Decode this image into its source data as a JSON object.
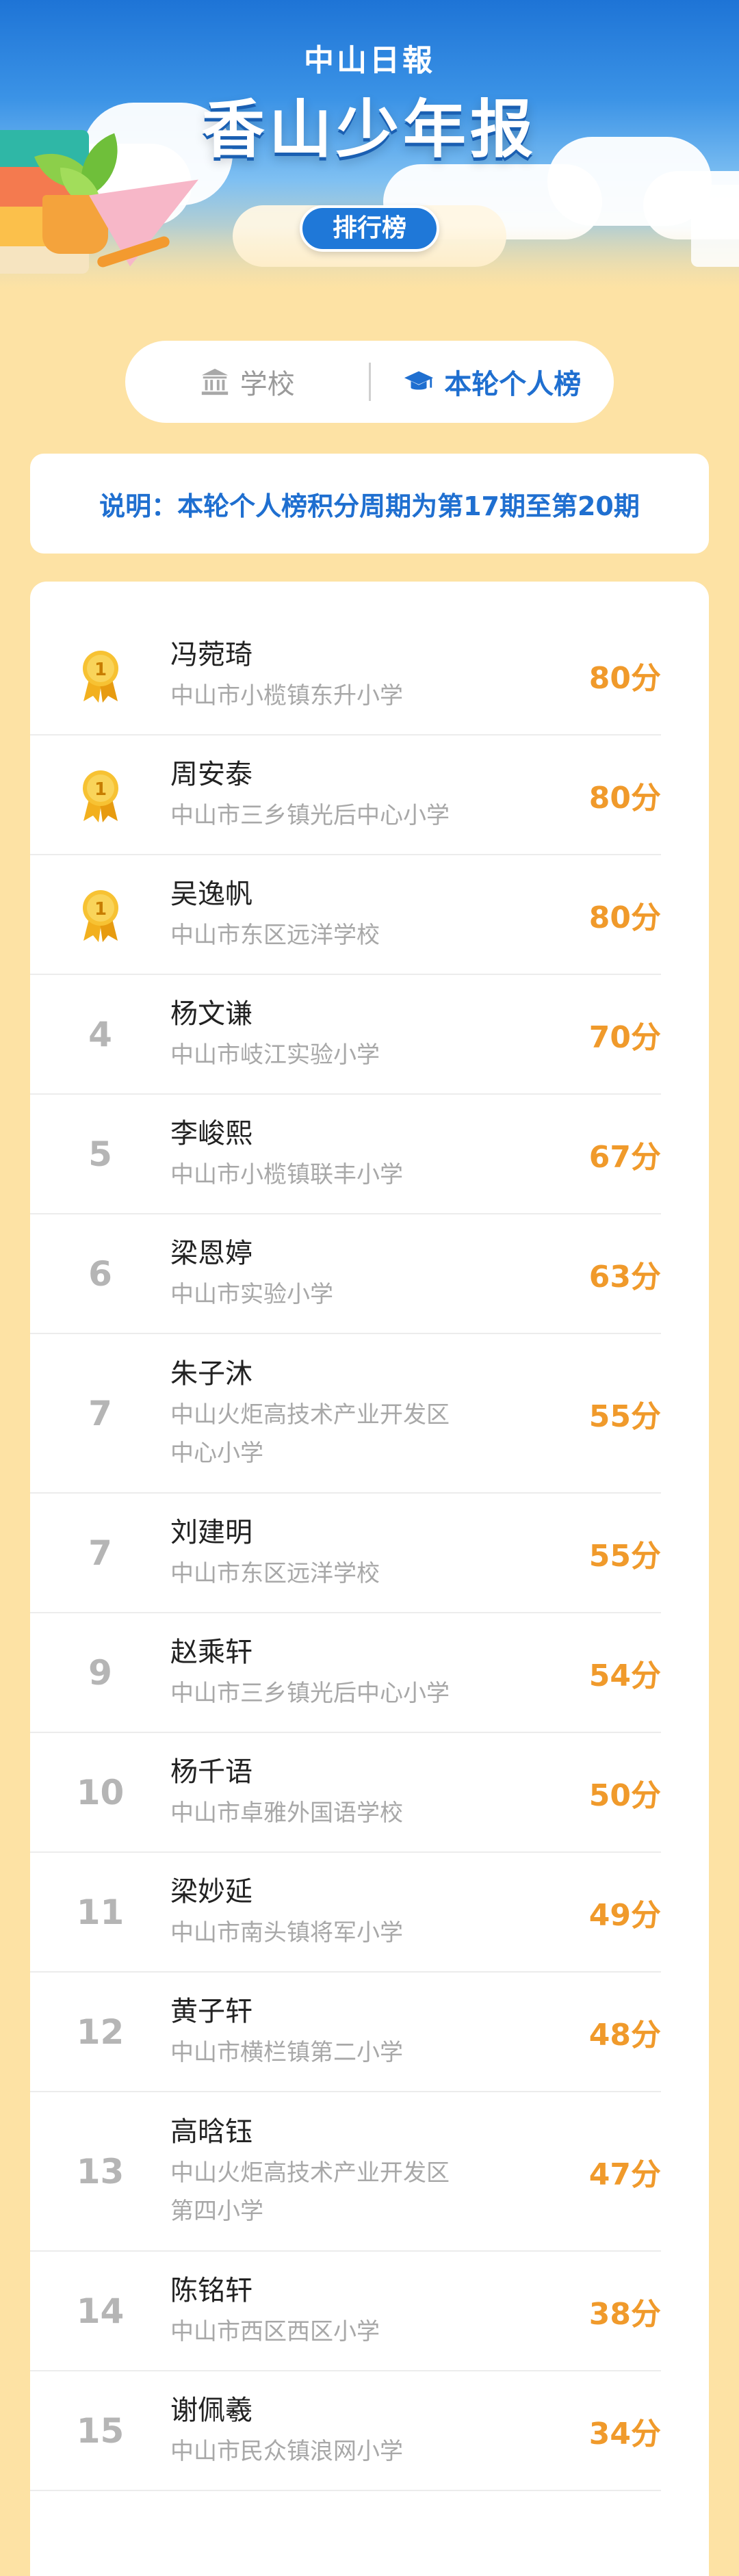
{
  "header": {
    "paper_name": "中山日報",
    "title": "香山少年报",
    "badge": "排行榜"
  },
  "tabs": {
    "school_label": "学校",
    "personal_label": "本轮个人榜",
    "active": "personal"
  },
  "notice": "说明：本轮个人榜积分周期为第17期至第20期",
  "colors": {
    "accent_blue": "#1f6fd0",
    "score_orange": "#f09a2b",
    "page_bg": "#fde2a4"
  },
  "rankings": [
    {
      "rank": "1",
      "medal": true,
      "name": "冯菀琦",
      "school": "中山市小榄镇东升小学",
      "score": "80分"
    },
    {
      "rank": "1",
      "medal": true,
      "name": "周安泰",
      "school": "中山市三乡镇光后中心小学",
      "score": "80分"
    },
    {
      "rank": "1",
      "medal": true,
      "name": "吴逸帆",
      "school": "中山市东区远洋学校",
      "score": "80分"
    },
    {
      "rank": "4",
      "medal": false,
      "name": "杨文谦",
      "school": "中山市岐江实验小学",
      "score": "70分"
    },
    {
      "rank": "5",
      "medal": false,
      "name": "李峻熙",
      "school": "中山市小榄镇联丰小学",
      "score": "67分"
    },
    {
      "rank": "6",
      "medal": false,
      "name": "梁恩婷",
      "school": "中山市实验小学",
      "score": "63分"
    },
    {
      "rank": "7",
      "medal": false,
      "name": "朱子沐",
      "school": "中山火炬高技术产业开发区中心小学",
      "score": "55分"
    },
    {
      "rank": "7",
      "medal": false,
      "name": "刘建明",
      "school": "中山市东区远洋学校",
      "score": "55分"
    },
    {
      "rank": "9",
      "medal": false,
      "name": "赵乘轩",
      "school": "中山市三乡镇光后中心小学",
      "score": "54分"
    },
    {
      "rank": "10",
      "medal": false,
      "name": "杨千语",
      "school": "中山市卓雅外国语学校",
      "score": "50分"
    },
    {
      "rank": "11",
      "medal": false,
      "name": "梁妙延",
      "school": "中山市南头镇将军小学",
      "score": "49分"
    },
    {
      "rank": "12",
      "medal": false,
      "name": "黄子轩",
      "school": "中山市横栏镇第二小学",
      "score": "48分"
    },
    {
      "rank": "13",
      "medal": false,
      "name": "高晗钰",
      "school": "中山火炬高技术产业开发区第四小学",
      "score": "47分"
    },
    {
      "rank": "14",
      "medal": false,
      "name": "陈铭轩",
      "school": "中山市西区西区小学",
      "score": "38分"
    },
    {
      "rank": "15",
      "medal": false,
      "name": "谢佩羲",
      "school": "中山市民众镇浪网小学",
      "score": "34分"
    }
  ]
}
